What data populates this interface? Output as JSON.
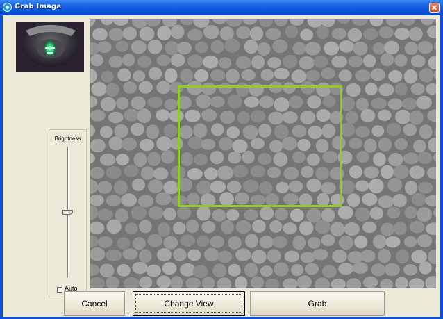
{
  "window": {
    "title": "Grab Image",
    "icons": {
      "app": "app-icon",
      "close": "close-icon"
    }
  },
  "brightness": {
    "label": "Brightness",
    "level_fraction": 0.5,
    "auto_label": "Auto",
    "auto_checked": false
  },
  "buttons": {
    "cancel": "Cancel",
    "change_view": "Change View",
    "grab": "Grab"
  },
  "colors": {
    "title_bar": "#1e66e8",
    "client_bg": "#ece9d8",
    "roi_outline": "#8ccf1e",
    "close_button": "#e04820"
  }
}
